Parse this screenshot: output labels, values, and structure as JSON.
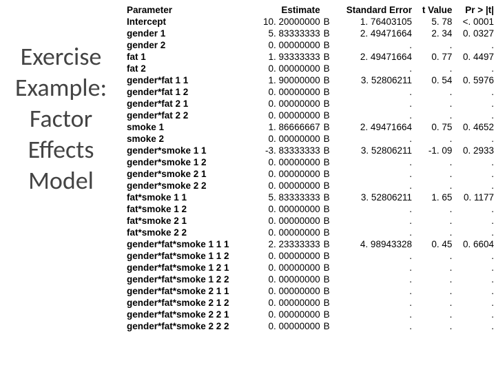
{
  "title_lines": [
    "Exercise",
    "Example:",
    "Factor",
    "Effects",
    "Model"
  ],
  "headers": {
    "parameter": "Parameter",
    "estimate": "Estimate",
    "stderr": "Standard Error",
    "tvalue": "t Value",
    "prt": "Pr > |t|"
  },
  "rows": [
    {
      "param": "Intercept",
      "est": "10. 20000000",
      "flag": "B",
      "se": "1. 76403105",
      "t": "5. 78",
      "p": "<. 0001"
    },
    {
      "param": "gender 1",
      "est": "5. 83333333",
      "flag": "B",
      "se": "2. 49471664",
      "t": "2. 34",
      "p": "0. 0327"
    },
    {
      "param": "gender 2",
      "est": "0. 00000000",
      "flag": "B",
      "se": ".",
      "t": ".",
      "p": "."
    },
    {
      "param": "fat 1",
      "est": "1. 93333333",
      "flag": "B",
      "se": "2. 49471664",
      "t": "0. 77",
      "p": "0. 4497"
    },
    {
      "param": "fat 2",
      "est": "0. 00000000",
      "flag": "B",
      "se": ".",
      "t": ".",
      "p": "."
    },
    {
      "param": "gender*fat 1 1",
      "est": "1. 90000000",
      "flag": "B",
      "se": "3. 52806211",
      "t": "0. 54",
      "p": "0. 5976"
    },
    {
      "param": "gender*fat 1 2",
      "est": "0. 00000000",
      "flag": "B",
      "se": ".",
      "t": ".",
      "p": "."
    },
    {
      "param": "gender*fat 2 1",
      "est": "0. 00000000",
      "flag": "B",
      "se": ".",
      "t": ".",
      "p": "."
    },
    {
      "param": "gender*fat 2 2",
      "est": "0. 00000000",
      "flag": "B",
      "se": ".",
      "t": ".",
      "p": "."
    },
    {
      "param": "smoke 1",
      "est": "1. 86666667",
      "flag": "B",
      "se": "2. 49471664",
      "t": "0. 75",
      "p": "0. 4652"
    },
    {
      "param": "smoke 2",
      "est": "0. 00000000",
      "flag": "B",
      "se": ".",
      "t": ".",
      "p": "."
    },
    {
      "param": "gender*smoke 1 1",
      "est": "-3. 83333333",
      "flag": "B",
      "se": "3. 52806211",
      "t": "-1. 09",
      "p": "0. 2933"
    },
    {
      "param": "gender*smoke 1 2",
      "est": "0. 00000000",
      "flag": "B",
      "se": ".",
      "t": ".",
      "p": "."
    },
    {
      "param": "gender*smoke 2 1",
      "est": "0. 00000000",
      "flag": "B",
      "se": ".",
      "t": ".",
      "p": "."
    },
    {
      "param": "gender*smoke 2 2",
      "est": "0. 00000000",
      "flag": "B",
      "se": ".",
      "t": ".",
      "p": "."
    },
    {
      "param": "fat*smoke 1 1",
      "est": "5. 83333333",
      "flag": "B",
      "se": "3. 52806211",
      "t": "1. 65",
      "p": "0. 1177"
    },
    {
      "param": "fat*smoke 1 2",
      "est": "0. 00000000",
      "flag": "B",
      "se": ".",
      "t": ".",
      "p": "."
    },
    {
      "param": "fat*smoke 2 1",
      "est": "0. 00000000",
      "flag": "B",
      "se": ".",
      "t": ".",
      "p": "."
    },
    {
      "param": "fat*smoke 2 2",
      "est": "0. 00000000",
      "flag": "B",
      "se": ".",
      "t": ".",
      "p": "."
    },
    {
      "param": "gender*fat*smoke 1 1 1",
      "est": "2. 23333333",
      "flag": "B",
      "se": "4. 98943328",
      "t": "0. 45",
      "p": "0. 6604"
    },
    {
      "param": "gender*fat*smoke 1 1 2",
      "est": "0. 00000000",
      "flag": "B",
      "se": ".",
      "t": ".",
      "p": "."
    },
    {
      "param": "gender*fat*smoke 1 2 1",
      "est": "0. 00000000",
      "flag": "B",
      "se": ".",
      "t": ".",
      "p": "."
    },
    {
      "param": "gender*fat*smoke 1 2 2",
      "est": "0. 00000000",
      "flag": "B",
      "se": ".",
      "t": ".",
      "p": "."
    },
    {
      "param": "gender*fat*smoke 2 1 1",
      "est": "0. 00000000",
      "flag": "B",
      "se": ".",
      "t": ".",
      "p": "."
    },
    {
      "param": "gender*fat*smoke 2 1 2",
      "est": "0. 00000000",
      "flag": "B",
      "se": ".",
      "t": ".",
      "p": "."
    },
    {
      "param": "gender*fat*smoke 2 2 1",
      "est": "0. 00000000",
      "flag": "B",
      "se": ".",
      "t": ".",
      "p": "."
    },
    {
      "param": "gender*fat*smoke 2 2 2",
      "est": "0. 00000000",
      "flag": "B",
      "se": ".",
      "t": ".",
      "p": "."
    }
  ]
}
